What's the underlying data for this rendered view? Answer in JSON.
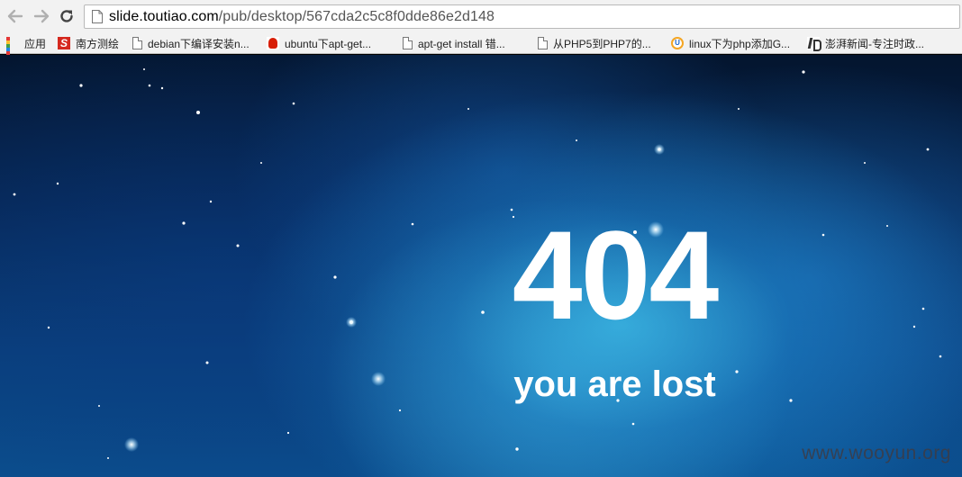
{
  "browser": {
    "url_host": "slide.toutiao.com",
    "url_path": "/pub/desktop/567cda2c5c8f0dde86e2d148"
  },
  "bookmarks": [
    {
      "label": "应用",
      "icon": "apps-grid-icon"
    },
    {
      "label": "南方测绘",
      "icon": "s-logo-icon"
    },
    {
      "label": "debian下编译安装n...",
      "icon": "page-icon"
    },
    {
      "label": "ubuntu下apt-get...",
      "icon": "baidu-paw-icon"
    },
    {
      "label": "apt-get install 错...",
      "icon": "page-icon"
    },
    {
      "label": "从PHP5到PHP7的...",
      "icon": "page-icon"
    },
    {
      "label": "linux下为php添加G...",
      "icon": "u-logo-icon"
    },
    {
      "label": "澎湃新闻-专注时政...",
      "icon": "thepaper-logo-icon"
    }
  ],
  "page": {
    "code": "404",
    "message": "you are lost",
    "watermark": "www.wooyun.org"
  },
  "colors": {
    "sky_dark": "#04152e",
    "nebula_light": "#3cbeeb",
    "text": "#ffffff"
  }
}
